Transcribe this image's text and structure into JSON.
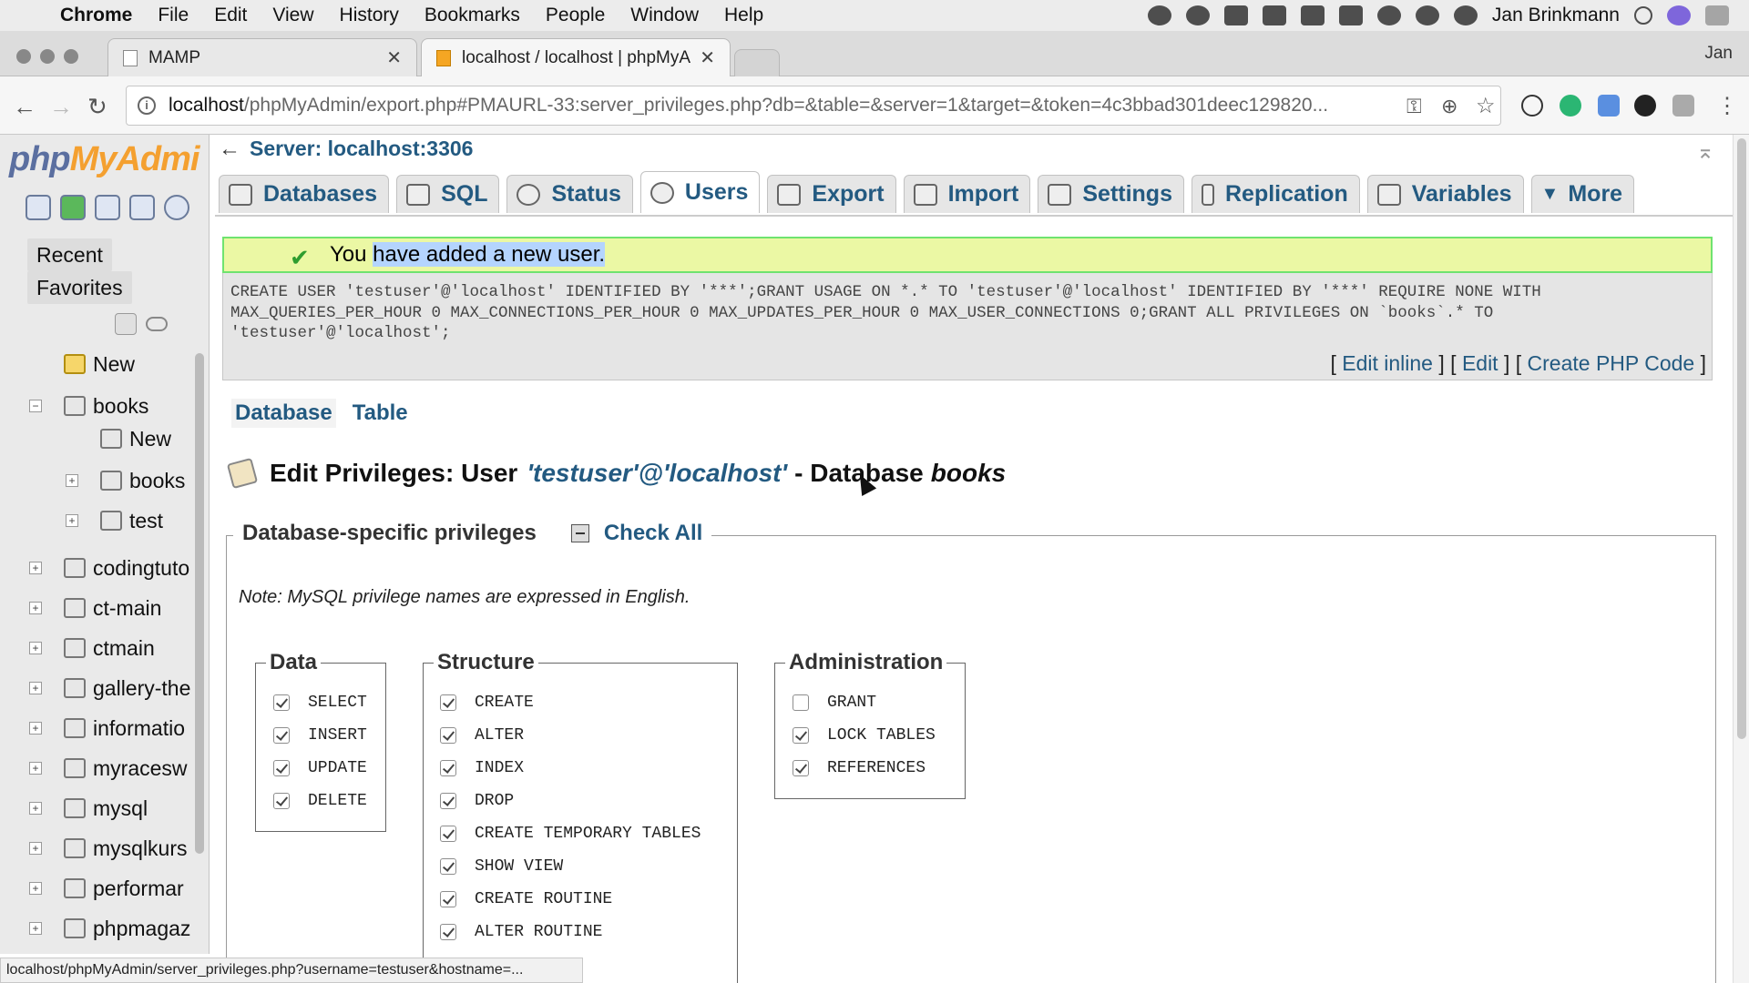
{
  "mac_menu": {
    "app": "Chrome",
    "items": [
      "File",
      "Edit",
      "View",
      "History",
      "Bookmarks",
      "People",
      "Window",
      "Help"
    ],
    "user": "Jan Brinkmann",
    "icons": [
      "creative-cloud-icon",
      "1password-icon",
      "dropbox-icon",
      "calendar-icon",
      "plus-icon",
      "camera-icon",
      "leaf-icon",
      "messages-icon",
      "time-machine-icon",
      "spotlight-icon",
      "siri-icon",
      "notification-icon"
    ]
  },
  "browser": {
    "tabs": [
      {
        "title": "MAMP",
        "active": false
      },
      {
        "title": "localhost / localhost | phpMyAd",
        "active": true
      }
    ],
    "profile_label": "Jan",
    "url_host": "localhost",
    "url_path": "/phpMyAdmin/export.php#PMAURL-33:server_privileges.php?db=&table=&server=1&target=&token=4c3bbad301deec129820...",
    "status_url": "localhost/phpMyAdmin/server_privileges.php?username=testuser&hostname=..."
  },
  "sidebar": {
    "logo_a": "php",
    "logo_b": "MyAdmi",
    "recent": "Recent",
    "favorites": "Favorites",
    "tree": [
      {
        "label": "New",
        "level": 0
      },
      {
        "label": "books",
        "level": 0
      },
      {
        "label": "New",
        "level": 1
      },
      {
        "label": "books",
        "level": 1
      },
      {
        "label": "test",
        "level": 1
      },
      {
        "label": "codingtuto",
        "level": 0
      },
      {
        "label": "ct-main",
        "level": 0
      },
      {
        "label": "ctmain",
        "level": 0
      },
      {
        "label": "gallery-the",
        "level": 0
      },
      {
        "label": "informatio",
        "level": 0
      },
      {
        "label": "myracesw",
        "level": 0
      },
      {
        "label": "mysql",
        "level": 0
      },
      {
        "label": "mysqlkurs",
        "level": 0
      },
      {
        "label": "performar",
        "level": 0
      },
      {
        "label": "phpmagaz",
        "level": 0
      }
    ]
  },
  "main": {
    "server": "Server: localhost:3306",
    "tabs": [
      "Databases",
      "SQL",
      "Status",
      "Users",
      "Export",
      "Import",
      "Settings",
      "Replication",
      "Variables",
      "More"
    ],
    "active_tab": "Users",
    "success_pre": "You ",
    "success_hl": "have added a new user.",
    "sql": "CREATE USER 'testuser'@'localhost' IDENTIFIED BY '***';GRANT USAGE ON *.* TO 'testuser'@'localhost' IDENTIFIED BY '***' REQUIRE NONE WITH MAX_QUERIES_PER_HOUR 0 MAX_CONNECTIONS_PER_HOUR 0 MAX_UPDATES_PER_HOUR 0 MAX_USER_CONNECTIONS 0;GRANT ALL PRIVILEGES ON `books`.* TO 'testuser'@'localhost';",
    "sql_links": [
      "Edit inline",
      "Edit",
      "Create PHP Code"
    ],
    "subnav": [
      "Database",
      "Table"
    ],
    "heading_pre": "Edit Privileges: User",
    "heading_user": "'testuser'@'localhost'",
    "heading_mid": "- Database",
    "heading_db": "books",
    "legend": "Database-specific privileges",
    "check_all": "Check All",
    "note": "Note: MySQL privilege names are expressed in English.",
    "groups": [
      {
        "title": "Data",
        "items": [
          {
            "label": "SELECT",
            "checked": true
          },
          {
            "label": "INSERT",
            "checked": true
          },
          {
            "label": "UPDATE",
            "checked": true
          },
          {
            "label": "DELETE",
            "checked": true
          }
        ]
      },
      {
        "title": "Structure",
        "items": [
          {
            "label": "CREATE",
            "checked": true
          },
          {
            "label": "ALTER",
            "checked": true
          },
          {
            "label": "INDEX",
            "checked": true
          },
          {
            "label": "DROP",
            "checked": true
          },
          {
            "label": "CREATE TEMPORARY TABLES",
            "checked": true
          },
          {
            "label": "SHOW VIEW",
            "checked": true
          },
          {
            "label": "CREATE ROUTINE",
            "checked": true
          },
          {
            "label": "ALTER ROUTINE",
            "checked": true
          }
        ]
      },
      {
        "title": "Administration",
        "items": [
          {
            "label": "GRANT",
            "checked": false
          },
          {
            "label": "LOCK TABLES",
            "checked": true
          },
          {
            "label": "REFERENCES",
            "checked": true
          }
        ]
      }
    ]
  },
  "colors": {
    "link": "#235a81",
    "success_bg": "#ebf8a4",
    "success_border": "#6fe36f",
    "sql_bg": "#e5e5e5"
  }
}
